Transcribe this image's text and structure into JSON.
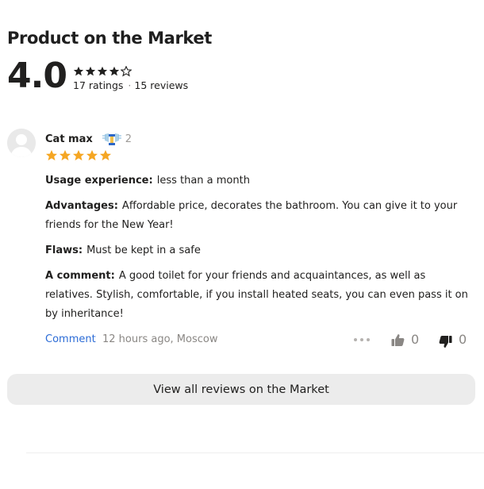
{
  "section": {
    "title": "Product on the Market",
    "rating_value": 4.0,
    "rating_display": "4.0",
    "ratings_count": "17 ratings",
    "separator": "·",
    "reviews_count": "15 reviews",
    "star_fill": 4,
    "star_total": 5
  },
  "review": {
    "author": "Cat max",
    "badge_icon": "reviewer-rank-icon",
    "badge_count": "2",
    "stars": 5,
    "fields": [
      {
        "label": "Usage experience:",
        "text": "less than a month"
      },
      {
        "label": "Advantages:",
        "text": "Affordable price, decorates the bathroom. You can give it to your friends for the New Year!"
      },
      {
        "label": "Flaws:",
        "text": "Must be kept in a safe"
      },
      {
        "label": "A comment:",
        "text": "A good toilet for your friends and acquaintances, as well as relatives. Stylish, comfortable, if you install heated seats, you can even pass it on by inheritance!"
      }
    ],
    "comment_link": "Comment",
    "meta": "12 hours ago, Moscow",
    "likes": "0",
    "dislikes": "0"
  },
  "actions": {
    "all_reviews_label": "View all reviews on the Market"
  },
  "colors": {
    "star_filled": "#f5a623",
    "star_dark": "#21201f",
    "link": "#2b6bd6",
    "muted": "#8a8784",
    "button_bg": "#ececec"
  }
}
